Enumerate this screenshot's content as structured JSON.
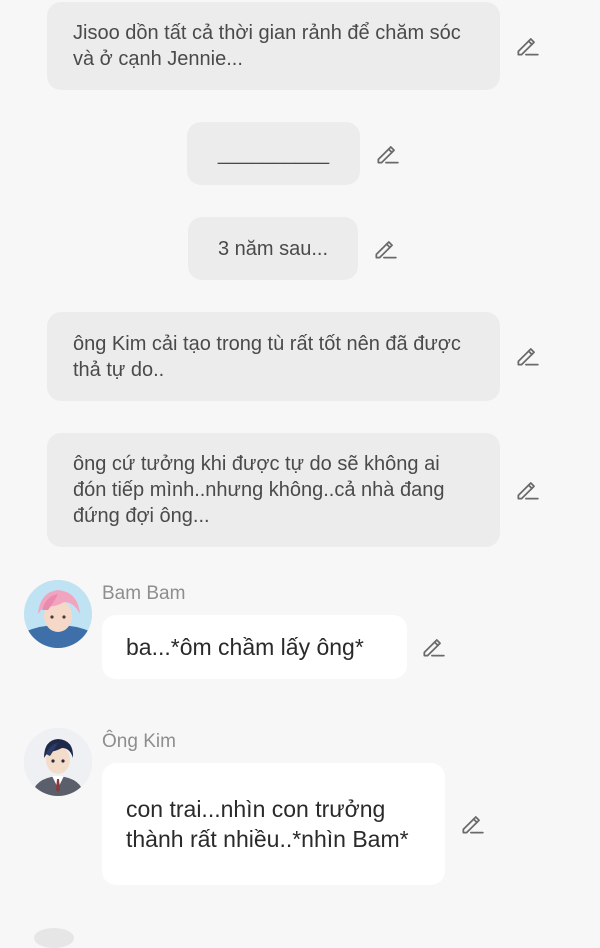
{
  "narrations": [
    {
      "text": "Jisoo dồn tất cả thời gian rảnh để chăm sóc và ở cạnh Jennie..."
    },
    {
      "text": "__________"
    },
    {
      "text": "3 năm sau..."
    },
    {
      "text": "ông Kim cải tạo trong tù rất tốt nên đã được thả tự do.."
    },
    {
      "text": "ông cứ tưởng khi được tự do sẽ không ai đón tiếp mình..nhưng không..cả nhà đang đứng đợi ông..."
    }
  ],
  "messages": [
    {
      "speaker": "Bam Bam",
      "text": "ba...*ôm chầm lấy ông*",
      "avatar_icon": "pink-hair-avatar-icon"
    },
    {
      "speaker": "Ông Kim",
      "text": "con trai...nhìn con trưởng thành rất nhiều..*nhìn Bam*",
      "avatar_icon": "suited-man-avatar-icon"
    }
  ],
  "edit_icon": "pencil-icon",
  "colors": {
    "background": "#f7f7f7",
    "narration_bubble": "#ececec",
    "chat_bubble": "#ffffff",
    "speaker_name": "#8e8e8e",
    "icon": "#6a6a6a"
  }
}
